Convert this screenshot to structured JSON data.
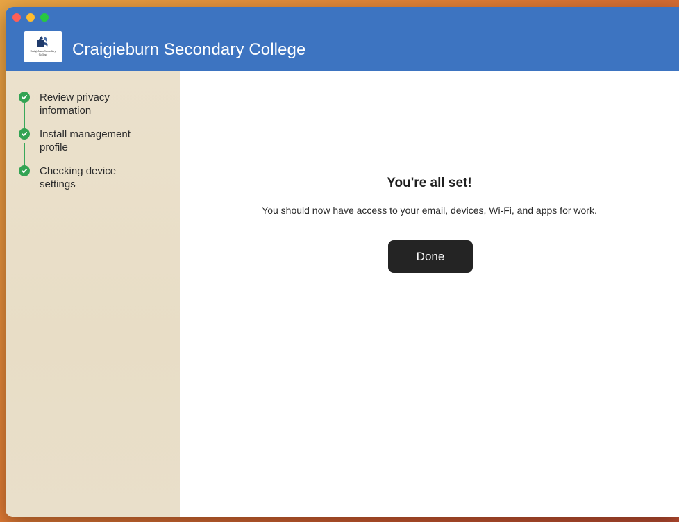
{
  "window": {
    "title": "Craigieburn Secondary College",
    "logo_text": "Craigieburn Secondary College"
  },
  "sidebar": {
    "steps": [
      {
        "label": "Review privacy information",
        "status": "complete"
      },
      {
        "label": "Install management profile",
        "status": "complete"
      },
      {
        "label": "Checking device settings",
        "status": "complete"
      }
    ]
  },
  "main": {
    "headline": "You're all set!",
    "message": "You should now have access to your email, devices, Wi-Fi, and apps for work.",
    "done_label": "Done"
  },
  "colors": {
    "titlebar": "#3d74c1",
    "step_complete": "#33a353",
    "button": "#242424"
  }
}
